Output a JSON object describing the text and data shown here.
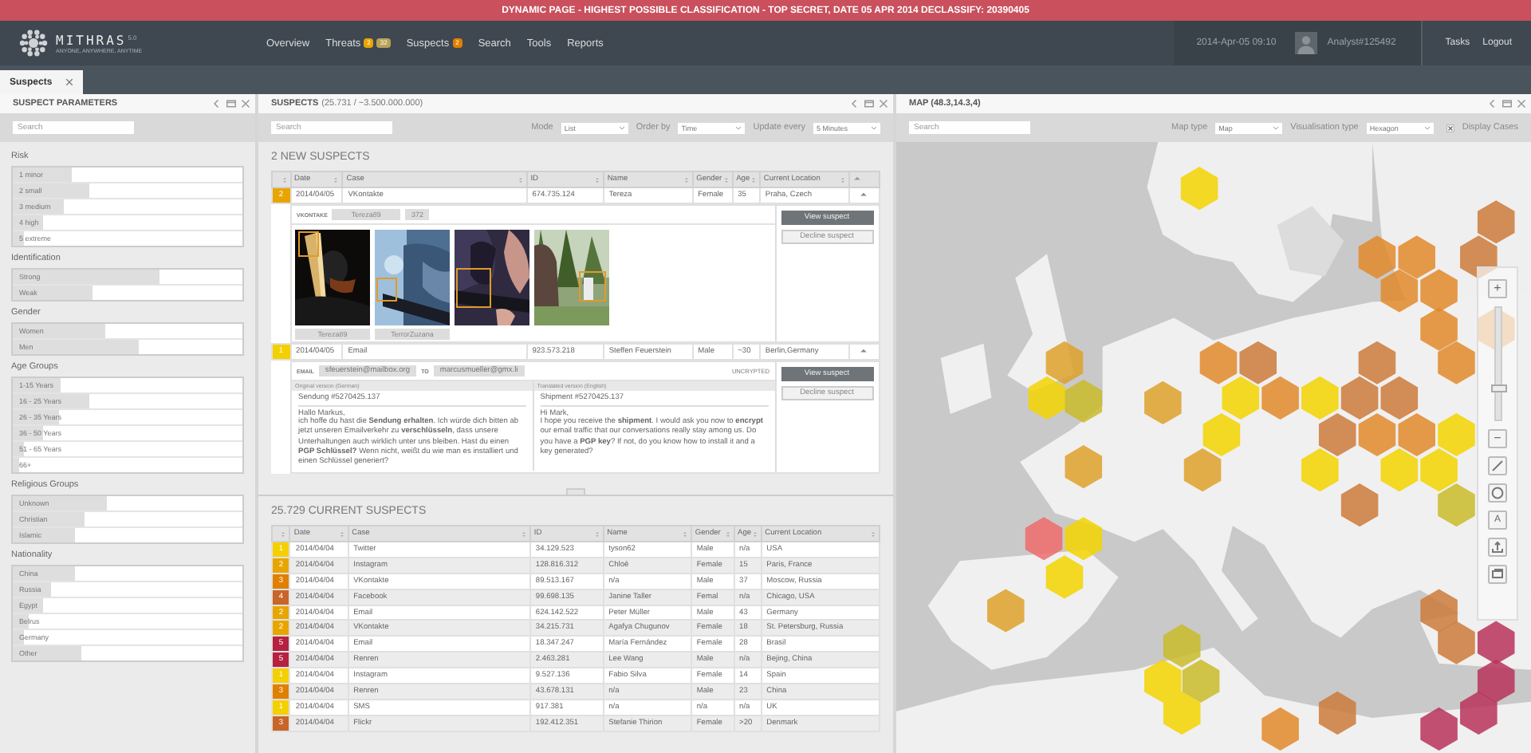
{
  "banner": "DYNAMIC PAGE - HIGHEST POSSIBLE CLASSIFICATION - TOP SECRET, DATE 05 APR 2014 DECLASSIFY: 20390405",
  "header": {
    "logo": "MITHRAS",
    "version": "5.0",
    "tagline": "ANYONE, ANYWHERE, ANYTIME",
    "nav": [
      {
        "label": "Overview"
      },
      {
        "label": "Threats",
        "badges": [
          {
            "text": "2",
            "color": "#e8a500"
          },
          {
            "text": "32",
            "color": "#b9a15a"
          }
        ]
      },
      {
        "label": "Suspects",
        "badges": [
          {
            "text": "2",
            "color": "#e07f00"
          }
        ]
      },
      {
        "label": "Search"
      },
      {
        "label": "Tools"
      },
      {
        "label": "Reports"
      }
    ],
    "datetime": "2014-Apr-05 09:10",
    "user": "Analyst#125492",
    "links": [
      "Tasks",
      "Logout"
    ]
  },
  "tabs": [
    {
      "label": "Suspects",
      "selected": true
    }
  ],
  "left_panel": {
    "title": "SUSPECT PARAMETERS",
    "search": {
      "placeholder": "Search"
    },
    "groups": [
      {
        "title": "Risk",
        "items": [
          {
            "label": "1 minor",
            "level": 0.26
          },
          {
            "label": "2 small",
            "level": 0.33
          },
          {
            "label": "3 medium",
            "level": 0.22
          },
          {
            "label": "4 high",
            "level": 0.13
          },
          {
            "label": "5 extreme",
            "level": 0.05
          }
        ]
      },
      {
        "title": "Identification",
        "items": [
          {
            "label": "Strong",
            "level": 0.64
          },
          {
            "label": "Weak",
            "level": 0.35
          }
        ]
      },
      {
        "title": "Gender",
        "items": [
          {
            "label": "Women",
            "level": 0.4
          },
          {
            "label": "Men",
            "level": 0.55
          }
        ]
      },
      {
        "title": "Age Groups",
        "items": [
          {
            "label": "1-15 Years",
            "level": 0.21
          },
          {
            "label": "16 - 25 Years",
            "level": 0.33
          },
          {
            "label": "26 - 35 Years",
            "level": 0.2
          },
          {
            "label": "36 - 50 Years",
            "level": 0.13
          },
          {
            "label": "51 - 65 Years",
            "level": 0.05
          },
          {
            "label": "66+",
            "level": 0.03
          }
        ]
      },
      {
        "title": "Religious Groups",
        "items": [
          {
            "label": "Unknown",
            "level": 0.41
          },
          {
            "label": "Christian",
            "level": 0.31
          },
          {
            "label": "Islamic",
            "level": 0.27
          }
        ]
      },
      {
        "title": "Nationality",
        "items": [
          {
            "label": "China",
            "level": 0.27
          },
          {
            "label": "Russia",
            "level": 0.17
          },
          {
            "label": "Egypt",
            "level": 0.13
          },
          {
            "label": "Belrus",
            "level": 0.07
          },
          {
            "label": "Germany",
            "level": 0.05
          },
          {
            "label": "Other",
            "level": 0.3
          }
        ]
      }
    ]
  },
  "suspects_panel": {
    "title": "SUSPECTS",
    "count": "(25.731 / ~3.500.000.000)",
    "search": {
      "placeholder": "Search"
    },
    "filters": [
      {
        "label": "Mode",
        "value": "List"
      },
      {
        "label": "Order by",
        "value": "Time"
      },
      {
        "label": "Update every",
        "value": "5 Minutes"
      }
    ],
    "new_title": "2 NEW SUSPECTS",
    "columns": [
      "Date",
      "Case",
      "ID",
      "Name",
      "Gender",
      "Age",
      "Current Location"
    ],
    "new_suspects": [
      {
        "risk": "2",
        "color": "#e8a500",
        "cells": [
          "2014/04/05",
          "VKontakte",
          "674.735.124",
          "Tereza",
          "Female",
          "35",
          "Praha, Czech"
        ],
        "expanded": true,
        "actions": [
          {
            "label": "View suspect",
            "primary": true
          },
          {
            "label": "Decline suspect",
            "primary": false
          }
        ],
        "detail": {
          "kind": "social",
          "network": "VKONTAKE",
          "account": "Tereza89",
          "friends": "372",
          "photos": [
            {
              "kind": "picture",
              "caption": "Tereza89"
            },
            {
              "kind": "picture",
              "caption": "TerrorZuzana"
            },
            {
              "kind": "picture"
            },
            {
              "kind": "picture"
            }
          ]
        }
      },
      {
        "risk": "1",
        "color": "#f5d000",
        "cells": [
          "2014/04/05",
          "Email",
          "923.573.218",
          "Steffen Feuerstein",
          "Male",
          "~30",
          "Berlin,Germany"
        ],
        "expanded": true,
        "actions": [
          {
            "label": "View suspect",
            "primary": true
          },
          {
            "label": "Decline suspect",
            "primary": false
          }
        ],
        "detail": {
          "kind": "email",
          "label": "EMAIL",
          "from": "sfeuerstein@mailbox.org",
          "to_label": "TO",
          "to": "marcusmueller@gmx.li",
          "status": "UNCRYPTED",
          "versions": [
            {
              "heading": "Original version (German)",
              "subject": "Sendung #5270425.137",
              "greeting": "Hallo Markus,",
              "body": "ich hoffe du hast die **Sendung erhalten**. Ich würde dich bitten ab jetzt unseren Emailverkehr zu **verschlüsseln**, dass unsere Unterhaltungen auch wirklich unter uns bleiben. Hast du einen **PGP Schlüssel?** Wenn nicht, weißt du wie man es installiert und einen Schlüssel generiert?"
            },
            {
              "heading": "Translated version (English)",
              "subject": "Shipment #5270425.137",
              "greeting": "Hi Mark,",
              "body": "I hope you receive the **shipment**. I would ask you now to **encrypt** our email traffic that our conversations really stay among us. Do you have a **PGP key**? If not, do you know how to install it and a key generated?"
            }
          ]
        }
      }
    ],
    "current_title": "25.729 CURRENT SUSPECTS",
    "current_columns": [
      "Date",
      "Case",
      "ID",
      "Name",
      "Gender",
      "Age",
      "Current Location"
    ],
    "rows": [
      {
        "risk": "1",
        "color": "#f5d000",
        "cells": [
          "2014/04/04",
          "Twitter",
          "34.129.523",
          "tyson62",
          "Male",
          "n/a",
          "USA"
        ]
      },
      {
        "risk": "2",
        "color": "#e8a500",
        "cells": [
          "2014/04/04",
          "Instagram",
          "128.816.312",
          "Chloé",
          "Female",
          "15",
          "Paris, France"
        ]
      },
      {
        "risk": "3",
        "color": "#e07f00",
        "cells": [
          "2014/04/04",
          "VKontakte",
          "89.513.167",
          "n/a",
          "Male",
          "37",
          "Moscow, Russia"
        ]
      },
      {
        "risk": "4",
        "color": "#c8652a",
        "cells": [
          "2014/04/04",
          "Facebook",
          "99.698.135",
          "Janine Taller",
          "Femal",
          "n/a",
          "Chicago, USA"
        ]
      },
      {
        "risk": "2",
        "color": "#e8a500",
        "cells": [
          "2014/04/04",
          "Email",
          "624.142.522",
          "Peter Müller",
          "Male",
          "43",
          "Germany"
        ]
      },
      {
        "risk": "2",
        "color": "#e8a500",
        "cells": [
          "2014/04/04",
          "VKontakte",
          "34.215.731",
          "Agafya Chugunov",
          "Female",
          "18",
          "St. Petersburg, Russia"
        ]
      },
      {
        "risk": "5",
        "color": "#b5213f",
        "cells": [
          "2014/04/04",
          "Email",
          "18.347.247",
          "María Fernández",
          "Female",
          "28",
          "Brasil"
        ]
      },
      {
        "risk": "5",
        "color": "#b5213f",
        "cells": [
          "2014/04/04",
          "Renren",
          "2.463.281",
          "Lee Wang",
          "Male",
          "n/a",
          "Bejing, China"
        ]
      },
      {
        "risk": "1",
        "color": "#f5d000",
        "cells": [
          "2014/04/04",
          "Instagram",
          "9.527.136",
          "Fabio Silva",
          "Female",
          "14",
          "Spain"
        ]
      },
      {
        "risk": "3",
        "color": "#e07f00",
        "cells": [
          "2014/04/04",
          "Renren",
          "43.678.131",
          "n/a",
          "Male",
          "23",
          "China"
        ]
      },
      {
        "risk": "1",
        "color": "#f5d000",
        "cells": [
          "2014/04/04",
          "SMS",
          "917.381",
          "n/a",
          "n/a",
          "n/a",
          "UK"
        ]
      },
      {
        "risk": "3",
        "color": "#c8652a",
        "cells": [
          "2014/04/04",
          "Flickr",
          "192.412.351",
          "Stefanie Thirion",
          "Female",
          ">20",
          "Denmark"
        ]
      }
    ]
  },
  "map_panel": {
    "title": "MAP (48.3,14.3,4)",
    "search": {
      "placeholder": "Search"
    },
    "filters": [
      {
        "label": "Map type",
        "value": "Map"
      },
      {
        "label": "Visualisation type",
        "value": "Hexagon"
      }
    ],
    "display_cases": {
      "label": "Display Cases",
      "checked": true
    },
    "zoom": {
      "zoom_in": "+",
      "zoom_out": "−",
      "level": 0.25,
      "text_tool": "A"
    }
  }
}
